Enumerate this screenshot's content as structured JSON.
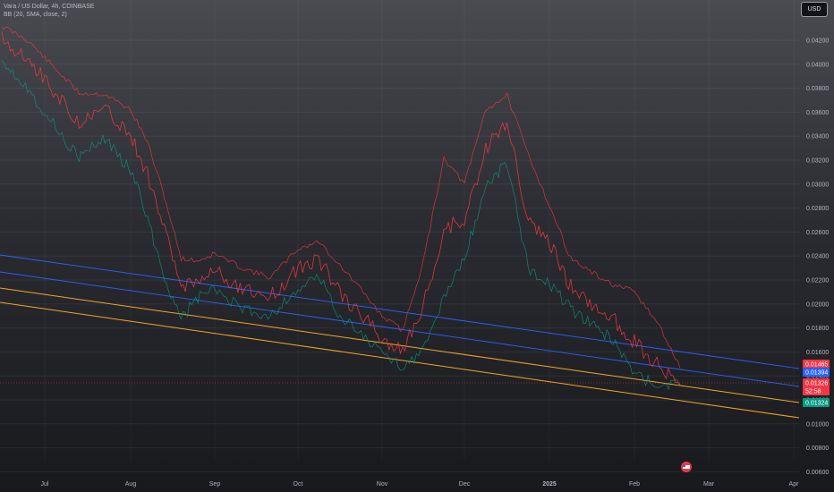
{
  "header": {
    "symbol_line": "Vara / US Dollar, 4h, COINBASE",
    "indicator_line": "BB (20, SMA, close, 2)"
  },
  "currency_button": "USD",
  "chart_data": {
    "type": "line",
    "title": "Vara / US Dollar, 4h, COINBASE",
    "indicator": "BB (20, SMA, close, 2)",
    "x_ticks": [
      "Jul",
      "Aug",
      "Sep",
      "Oct",
      "Nov",
      "Dec",
      "2025",
      "Feb",
      "Mar",
      "Apr"
    ],
    "y_ticks": [
      "0.04200",
      "0.04000",
      "0.03800",
      "0.03600",
      "0.03400",
      "0.03200",
      "0.03000",
      "0.02800",
      "0.02600",
      "0.02400",
      "0.02200",
      "0.02000",
      "0.01800",
      "0.01600",
      "0.01400",
      "0.01200",
      "0.01000",
      "0.00800",
      "0.00600"
    ],
    "ylim": [
      0.0055,
      0.0435
    ],
    "grid": true,
    "colors": {
      "upper_band": "#f23645",
      "basis": "#2962ff",
      "lower_band": "#089981",
      "price": "#f23645",
      "support_line": "#f5a623",
      "channel_line": "#2962ff"
    },
    "series": [
      {
        "key": "close",
        "points": [
          [
            "Jul",
            0.0422
          ],
          [
            "Jul",
            0.0405
          ],
          [
            "Jul",
            0.0378
          ],
          [
            "Jul",
            0.0352
          ],
          [
            "Jul",
            0.0362
          ],
          [
            "Aug",
            0.034
          ],
          [
            "Aug",
            0.0308
          ],
          [
            "Aug",
            0.0262
          ],
          [
            "Aug",
            0.0215
          ],
          [
            "Aug",
            0.0222
          ],
          [
            "Sep",
            0.0228
          ],
          [
            "Sep",
            0.0212
          ],
          [
            "Sep",
            0.0206
          ],
          [
            "Oct",
            0.023
          ],
          [
            "Oct",
            0.0238
          ],
          [
            "Oct",
            0.0208
          ],
          [
            "Oct",
            0.0192
          ],
          [
            "Nov",
            0.0172
          ],
          [
            "Nov",
            0.016
          ],
          [
            "Nov",
            0.0198
          ],
          [
            "Nov",
            0.0262
          ],
          [
            "Dec",
            0.027
          ],
          [
            "Dec",
            0.033
          ],
          [
            "Dec",
            0.0352
          ],
          [
            "Dec",
            0.0268
          ],
          [
            "2025",
            0.025
          ],
          [
            "2025",
            0.0215
          ],
          [
            "2025",
            0.02
          ],
          [
            "2025",
            0.0188
          ],
          [
            "Feb",
            0.0168
          ],
          [
            "Feb",
            0.0148
          ],
          [
            "Feb",
            0.01326
          ]
        ]
      },
      {
        "key": "bb_upper",
        "points": [
          [
            "Jul",
            0.0432
          ],
          [
            "Jul",
            0.042
          ],
          [
            "Jul",
            0.0398
          ],
          [
            "Jul",
            0.0376
          ],
          [
            "Jul",
            0.0375
          ],
          [
            "Aug",
            0.0362
          ],
          [
            "Aug",
            0.0335
          ],
          [
            "Aug",
            0.029
          ],
          [
            "Aug",
            0.0238
          ],
          [
            "Aug",
            0.0236
          ],
          [
            "Sep",
            0.0242
          ],
          [
            "Sep",
            0.023
          ],
          [
            "Sep",
            0.0222
          ],
          [
            "Oct",
            0.0246
          ],
          [
            "Oct",
            0.0252
          ],
          [
            "Oct",
            0.0232
          ],
          [
            "Oct",
            0.0212
          ],
          [
            "Nov",
            0.019
          ],
          [
            "Nov",
            0.0178
          ],
          [
            "Nov",
            0.0235
          ],
          [
            "Nov",
            0.0322
          ],
          [
            "Dec",
            0.03
          ],
          [
            "Dec",
            0.0362
          ],
          [
            "Dec",
            0.0374
          ],
          [
            "Dec",
            0.0325
          ],
          [
            "2025",
            0.0282
          ],
          [
            "2025",
            0.0238
          ],
          [
            "2025",
            0.0226
          ],
          [
            "2025",
            0.0216
          ],
          [
            "Feb",
            0.021
          ],
          [
            "Feb",
            0.0182
          ],
          [
            "Feb",
            0.01465
          ]
        ]
      },
      {
        "key": "bb_lower",
        "points": [
          [
            "Jul",
            0.0405
          ],
          [
            "Jul",
            0.038
          ],
          [
            "Jul",
            0.035
          ],
          [
            "Jul",
            0.0322
          ],
          [
            "Jul",
            0.0338
          ],
          [
            "Aug",
            0.0312
          ],
          [
            "Aug",
            0.0272
          ],
          [
            "Aug",
            0.0222
          ],
          [
            "Aug",
            0.0188
          ],
          [
            "Aug",
            0.0205
          ],
          [
            "Sep",
            0.0212
          ],
          [
            "Sep",
            0.0195
          ],
          [
            "Sep",
            0.019
          ],
          [
            "Oct",
            0.0212
          ],
          [
            "Oct",
            0.0222
          ],
          [
            "Oct",
            0.019
          ],
          [
            "Oct",
            0.0175
          ],
          [
            "Nov",
            0.0158
          ],
          [
            "Nov",
            0.0148
          ],
          [
            "Nov",
            0.016
          ],
          [
            "Nov",
            0.0205
          ],
          [
            "Dec",
            0.0238
          ],
          [
            "Dec",
            0.0298
          ],
          [
            "Dec",
            0.0318
          ],
          [
            "Dec",
            0.023
          ],
          [
            "2025",
            0.0218
          ],
          [
            "2025",
            0.0196
          ],
          [
            "2025",
            0.0182
          ],
          [
            "2025",
            0.017
          ],
          [
            "Feb",
            0.014
          ],
          [
            "Feb",
            0.0132
          ],
          [
            "Feb",
            0.01324
          ]
        ]
      }
    ],
    "price_tags": [
      {
        "label": "0.01465",
        "value": 0.01465,
        "color": "#f23645"
      },
      {
        "label": "0.01394",
        "value": 0.01394,
        "color": "#2962ff"
      },
      {
        "label": "0.01326",
        "value": 0.01326,
        "color": "#f23645"
      },
      {
        "label": "52:58",
        "value": 0.0129,
        "color": "#f23645"
      },
      {
        "label": "0.01324",
        "value": 0.0125,
        "color": "#089981"
      }
    ]
  }
}
